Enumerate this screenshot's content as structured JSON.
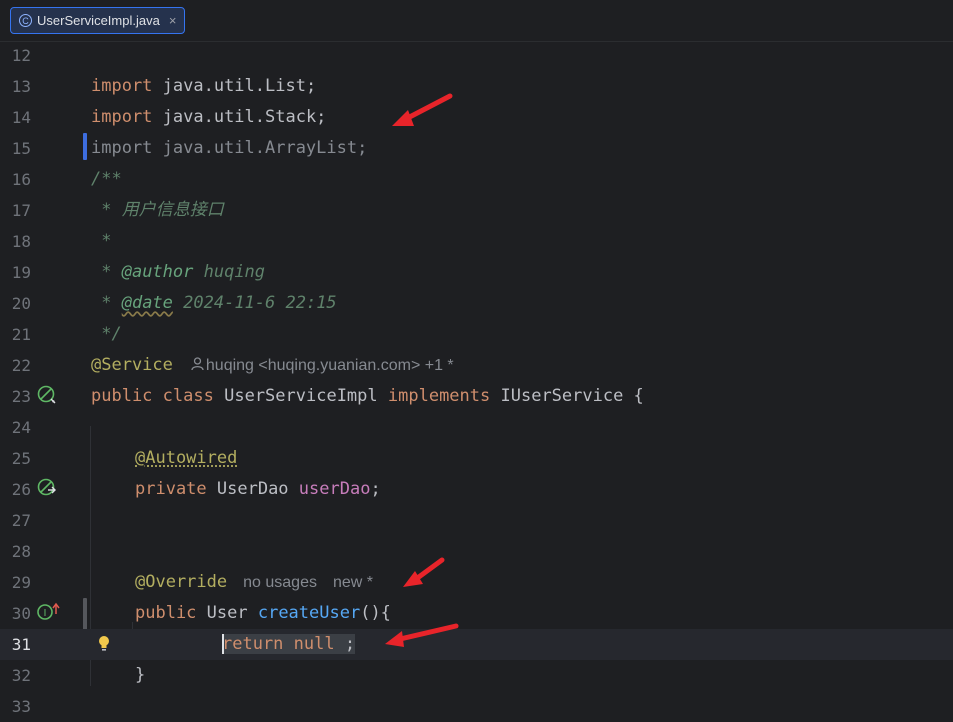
{
  "tab": {
    "filename": "UserServiceImpl.java",
    "icon": "class-icon",
    "close": "×"
  },
  "lines": {
    "l12": "12",
    "l13": "13",
    "l14": "14",
    "l15": "15",
    "l16": "16",
    "l17": "17",
    "l18": "18",
    "l19": "19",
    "l20": "20",
    "l21": "21",
    "l22": "22",
    "l23": "23",
    "l24": "24",
    "l25": "25",
    "l26": "26",
    "l27": "27",
    "l28": "28",
    "l29": "29",
    "l30": "30",
    "l31": "31",
    "l32": "32",
    "l33": "33"
  },
  "code": {
    "import_kw": "import",
    "imp1": " java.util.List;",
    "imp2": " java.util.Stack;",
    "imp3": "import java.util.ArrayList;",
    "doc_open": "/**",
    "doc_desc": " * 用户信息接口",
    "doc_blank": " *",
    "doc_star": " * ",
    "doc_author_tag": "@author",
    "doc_author_val": " huqing",
    "doc_date_tag": "@date",
    "doc_date_val": " 2024-11-6 22:15",
    "doc_close": " */",
    "service_ann": "@Service",
    "author_hint": "huqing <huqing.yuanian.com> +1 *",
    "public_kw": "public",
    "class_kw": "class",
    "class_name": "UserServiceImpl",
    "implements_kw": "implements",
    "iface": "IUserService {",
    "autowired": "@Autowired",
    "private_kw": "private",
    "dao_type": " UserDao ",
    "dao_field": "userDao",
    "semicolon": ";",
    "override": "@Override",
    "usages_hint": "no usages",
    "new_hint": "new *",
    "user_type": " User ",
    "method_name": "createUser",
    "method_tail": "(){",
    "return_kw": "return",
    "null_kw": "null",
    "ret_tail": " ;",
    "close_brace": "}"
  }
}
